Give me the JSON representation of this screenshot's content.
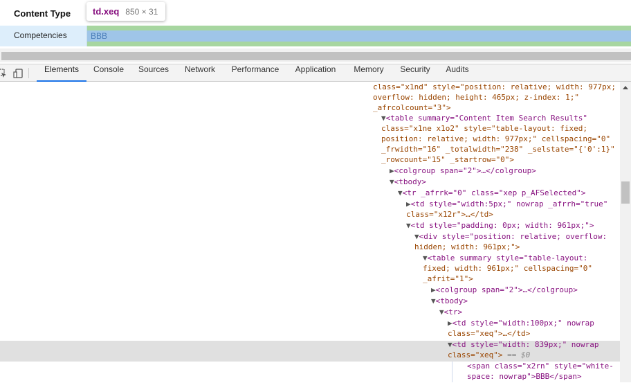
{
  "page": {
    "content_type_label": "Content Type",
    "row_label": "Competencies",
    "cell_value": "BBB"
  },
  "tooltip": {
    "tag": "td.xeq",
    "dims": "850 × 31"
  },
  "devtools": {
    "tabs": [
      {
        "label": "Elements",
        "active": true
      },
      {
        "label": "Console"
      },
      {
        "label": "Sources"
      },
      {
        "label": "Network"
      },
      {
        "label": "Performance"
      },
      {
        "label": "Application"
      },
      {
        "label": "Memory"
      },
      {
        "label": "Security"
      },
      {
        "label": "Audits"
      }
    ],
    "icons": [
      "inspect-icon",
      "device-toolbar-icon"
    ],
    "colors": {
      "accent": "#1a73e8",
      "tag": "#881280",
      "attr": "#994500",
      "value": "#1a1aa6"
    }
  },
  "dom": {
    "lines": [
      {
        "l1": "class=\"x1nd\" style=\"position: relative; width: 977px;"
      },
      {
        "l2": "overflow: hidden; height: 465px; z-index: 1;\""
      },
      {
        "l3": "_afrcolcount=\"3\">"
      },
      {
        "l4a": "▼",
        "l4b": "<table summary=\"Content Item Search Results\""
      },
      {
        "l5": "class=\"x1ne x1o2\" style=\"table-layout: fixed;"
      },
      {
        "l6": "position: relative; width: 977px;\" cellspacing=\"0\""
      },
      {
        "l7": "_frwidth=\"16\" _totalwidth=\"238\" _selstate=\"{'0':1}\""
      },
      {
        "l8": "_rowcount=\"15\" _startrow=\"0\">"
      },
      {
        "l9a": "▶",
        "l9b": "<colgroup span=\"2\">…</colgroup>"
      },
      {
        "l10a": "▼",
        "l10b": "<tbody>"
      },
      {
        "l11a": "▼",
        "l11b": "<tr _afrrk=\"0\" class=\"xep p_AFSelected\">"
      },
      {
        "l12a": "▶",
        "l12b": "<td style=\"width:5px;\" nowrap _afrrh=\"true\""
      },
      {
        "l13": "class=\"x12r\">…</td>"
      },
      {
        "l14a": "▼",
        "l14b": "<td style=\"padding: 0px; width: 961px;\">"
      },
      {
        "l15a": "▼",
        "l15b": "<div style=\"position: relative; overflow:"
      },
      {
        "l16": "hidden; width: 961px;\">"
      },
      {
        "l17a": "▼",
        "l17b": "<table summary style=\"table-layout:"
      },
      {
        "l18": "fixed; width: 961px;\" cellspacing=\"0\""
      },
      {
        "l19": "_afrit=\"1\">"
      },
      {
        "l20a": "▶",
        "l20b": "<colgroup span=\"2\">…</colgroup>"
      },
      {
        "l21a": "▼",
        "l21b": "<tbody>"
      },
      {
        "l22a": "▼",
        "l22b": "<tr>"
      },
      {
        "l23a": "▶",
        "l23b": "<td style=\"width:100px;\" nowrap"
      },
      {
        "l24": "class=\"xeq\">…</td>"
      },
      {
        "l25a": "▼",
        "l25b": "<td style=\"width: 839px;\" nowrap"
      },
      {
        "l26a": "class=\"xeq\">",
        "l26b": " == $0"
      },
      {
        "l27": "<span class=\"x2rn\" style=\"white-"
      },
      {
        "l28": "space: nowrap\">BBB</span>"
      }
    ]
  }
}
